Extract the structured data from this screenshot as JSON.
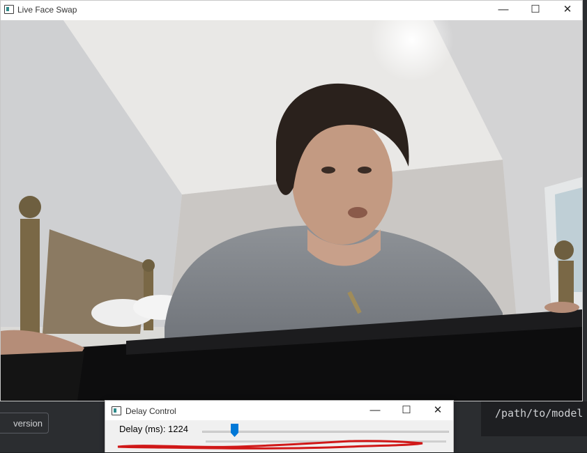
{
  "main_window": {
    "title": "Live Face Swap",
    "controls": {
      "minimize": "—",
      "maximize": "☐",
      "close": "✕"
    }
  },
  "dialog": {
    "title": "Delay Control",
    "controls": {
      "minimize": "—",
      "maximize": "☐",
      "close": "✕"
    },
    "delay_label": "Delay (ms): 1224",
    "slider_value": 1224
  },
  "background": {
    "conversion_button": "version",
    "terminal_text": "/path/to/model"
  },
  "colors": {
    "slider_thumb": "#0078d7",
    "annotation": "#d01818"
  }
}
